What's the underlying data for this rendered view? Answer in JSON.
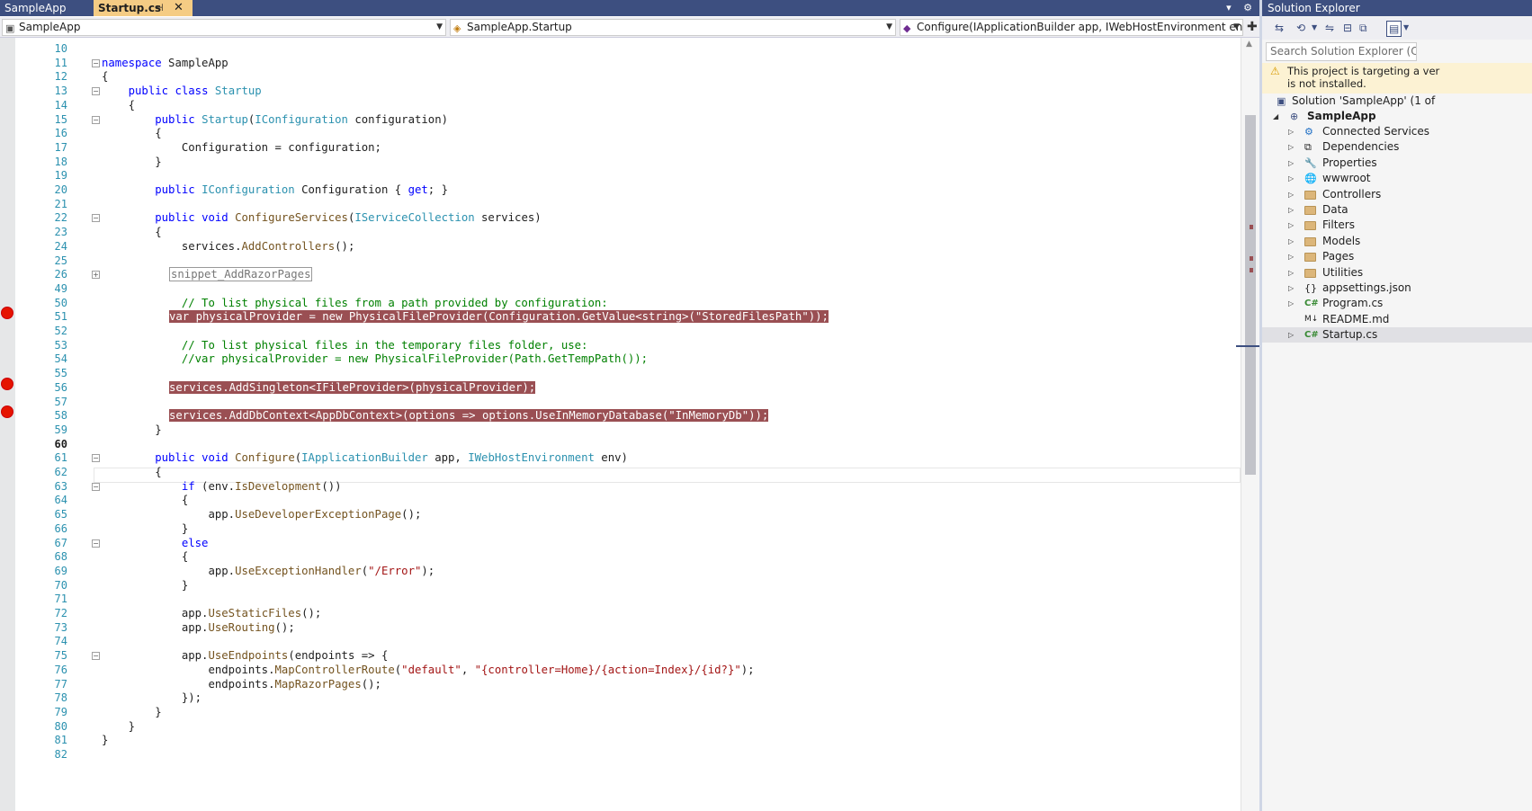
{
  "tabs": {
    "project_label": "SampleApp",
    "active_file_label": "Startup.cs",
    "pin_glyph": "⊣",
    "close_glyph": "✕",
    "overflow_glyph": "▾",
    "settings_glyph": "⚙"
  },
  "navbar": {
    "project": "SampleApp",
    "class": "SampleApp.Startup",
    "member": "Configure(IApplicationBuilder app, IWebHostEnvironment env)"
  },
  "editor": {
    "current_line": 60,
    "lines": [
      {
        "n": 10,
        "text": ""
      },
      {
        "n": 11,
        "text": "namespace SampleApp"
      },
      {
        "n": 12,
        "text": "{"
      },
      {
        "n": 13,
        "text": "    public class Startup"
      },
      {
        "n": 14,
        "text": "    {"
      },
      {
        "n": 15,
        "text": "        public Startup(IConfiguration configuration)"
      },
      {
        "n": 16,
        "text": "        {"
      },
      {
        "n": 17,
        "text": "            Configuration = configuration;"
      },
      {
        "n": 18,
        "text": "        }"
      },
      {
        "n": 19,
        "text": ""
      },
      {
        "n": 20,
        "text": "        public IConfiguration Configuration { get; }"
      },
      {
        "n": 21,
        "text": ""
      },
      {
        "n": 22,
        "text": "        public void ConfigureServices(IServiceCollection services)"
      },
      {
        "n": 23,
        "text": "        {"
      },
      {
        "n": 24,
        "text": "            services.AddControllers();"
      },
      {
        "n": 25,
        "text": ""
      },
      {
        "n": 26,
        "text": "snippet_AddRazorPages",
        "collapsed": true
      },
      {
        "n": 49,
        "text": ""
      },
      {
        "n": 50,
        "text": "            // To list physical files from a path provided by configuration:",
        "comment": true
      },
      {
        "n": 51,
        "text": "var physicalProvider = new PhysicalFileProvider(Configuration.GetValue<string>(\"StoredFilesPath\"));",
        "breakpoint": true
      },
      {
        "n": 52,
        "text": ""
      },
      {
        "n": 53,
        "text": "            // To list physical files in the temporary files folder, use:",
        "comment": true
      },
      {
        "n": 54,
        "text": "            //var physicalProvider = new PhysicalFileProvider(Path.GetTempPath());",
        "comment": true
      },
      {
        "n": 55,
        "text": ""
      },
      {
        "n": 56,
        "text": "services.AddSingleton<IFileProvider>(physicalProvider);",
        "breakpoint": true
      },
      {
        "n": 57,
        "text": ""
      },
      {
        "n": 58,
        "text": "services.AddDbContext<AppDbContext>(options => options.UseInMemoryDatabase(\"InMemoryDb\"));",
        "breakpoint": true
      },
      {
        "n": 59,
        "text": "        }"
      },
      {
        "n": 60,
        "text": ""
      },
      {
        "n": 61,
        "text": "        public void Configure(IApplicationBuilder app, IWebHostEnvironment env)"
      },
      {
        "n": 62,
        "text": "        {"
      },
      {
        "n": 63,
        "text": "            if (env.IsDevelopment())"
      },
      {
        "n": 64,
        "text": "            {"
      },
      {
        "n": 65,
        "text": "                app.UseDeveloperExceptionPage();"
      },
      {
        "n": 66,
        "text": "            }"
      },
      {
        "n": 67,
        "text": "            else"
      },
      {
        "n": 68,
        "text": "            {"
      },
      {
        "n": 69,
        "text": "                app.UseExceptionHandler(\"/Error\");"
      },
      {
        "n": 70,
        "text": "            }"
      },
      {
        "n": 71,
        "text": ""
      },
      {
        "n": 72,
        "text": "            app.UseStaticFiles();"
      },
      {
        "n": 73,
        "text": "            app.UseRouting();"
      },
      {
        "n": 74,
        "text": ""
      },
      {
        "n": 75,
        "text": "            app.UseEndpoints(endpoints => {"
      },
      {
        "n": 76,
        "text": "                endpoints.MapControllerRoute(\"default\", \"{controller=Home}/{action=Index}/{id?}\");"
      },
      {
        "n": 77,
        "text": "                endpoints.MapRazorPages();"
      },
      {
        "n": 78,
        "text": "            });"
      },
      {
        "n": 79,
        "text": "        }"
      },
      {
        "n": 80,
        "text": "    }"
      },
      {
        "n": 81,
        "text": "}"
      },
      {
        "n": 82,
        "text": ""
      }
    ],
    "fold_lines": [
      11,
      13,
      15,
      22,
      26,
      61,
      63,
      67,
      75
    ]
  },
  "solution_explorer": {
    "title": "Solution Explorer",
    "search_placeholder": "Search Solution Explorer (Ctrl+;)",
    "warning_line1": "This project is targeting a ver",
    "warning_line2": "is not installed.",
    "solution_label": "Solution 'SampleApp' (1 of",
    "project_label": "SampleApp",
    "items": [
      {
        "label": "Connected Services",
        "icon": "connected-services-icon",
        "glyph": "⚙",
        "expandable": true
      },
      {
        "label": "Dependencies",
        "icon": "dependencies-icon",
        "glyph": "⧉",
        "expandable": true
      },
      {
        "label": "Properties",
        "icon": "wrench-icon",
        "glyph": "🔧",
        "expandable": true
      },
      {
        "label": "wwwroot",
        "icon": "globe-icon",
        "glyph": "🌐",
        "expandable": true
      },
      {
        "label": "Controllers",
        "icon": "folder-icon",
        "glyph": "",
        "expandable": true
      },
      {
        "label": "Data",
        "icon": "folder-icon",
        "glyph": "",
        "expandable": true
      },
      {
        "label": "Filters",
        "icon": "folder-icon",
        "glyph": "",
        "expandable": true
      },
      {
        "label": "Models",
        "icon": "folder-icon",
        "glyph": "",
        "expandable": true
      },
      {
        "label": "Pages",
        "icon": "folder-icon",
        "glyph": "",
        "expandable": true
      },
      {
        "label": "Utilities",
        "icon": "folder-icon",
        "glyph": "",
        "expandable": true
      },
      {
        "label": "appsettings.json",
        "icon": "json-file-icon",
        "glyph": "{}",
        "expandable": true
      },
      {
        "label": "Program.cs",
        "icon": "csharp-file-icon",
        "glyph": "C#",
        "expandable": true
      },
      {
        "label": "README.md",
        "icon": "markdown-file-icon",
        "glyph": "M↓",
        "expandable": false
      },
      {
        "label": "Startup.cs",
        "icon": "csharp-file-icon",
        "glyph": "C#",
        "expandable": true,
        "selected": true
      }
    ]
  },
  "colors": {
    "title_bar": "#3d4f80",
    "active_tab": "#f5cc84",
    "breakpoint_fill": "#e51400",
    "breakpoint_highlight": "#9a4f53",
    "keyword": "#0000ff",
    "type": "#2b91af",
    "comment": "#008000",
    "string": "#a31515",
    "line_number": "#2b91af"
  }
}
